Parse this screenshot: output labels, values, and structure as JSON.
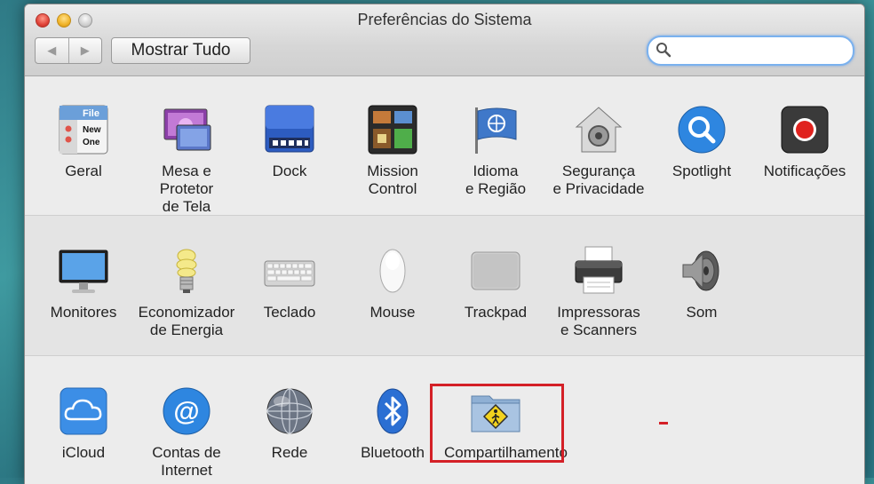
{
  "window": {
    "title": "Preferências do Sistema"
  },
  "toolbar": {
    "back_label": "◀",
    "forward_label": "▶",
    "show_all_label": "Mostrar Tudo",
    "search": {
      "value": "",
      "placeholder": ""
    }
  },
  "sections": [
    {
      "panes": [
        {
          "label": "Geral",
          "icon": "general-icon"
        },
        {
          "label": "Mesa e Protetor\nde Tela",
          "icon": "desktop-screensaver-icon"
        },
        {
          "label": "Dock",
          "icon": "dock-icon"
        },
        {
          "label": "Mission\nControl",
          "icon": "mission-control-icon"
        },
        {
          "label": "Idioma\ne Região",
          "icon": "language-region-icon"
        },
        {
          "label": "Segurança\ne Privacidade",
          "icon": "security-privacy-icon"
        },
        {
          "label": "Spotlight",
          "icon": "spotlight-icon"
        },
        {
          "label": "Notificações",
          "icon": "notifications-icon"
        }
      ]
    },
    {
      "panes": [
        {
          "label": "Monitores",
          "icon": "displays-icon"
        },
        {
          "label": "Economizador\nde Energia",
          "icon": "energy-saver-icon"
        },
        {
          "label": "Teclado",
          "icon": "keyboard-icon"
        },
        {
          "label": "Mouse",
          "icon": "mouse-icon"
        },
        {
          "label": "Trackpad",
          "icon": "trackpad-icon"
        },
        {
          "label": "Impressoras\ne Scanners",
          "icon": "printers-scanners-icon"
        },
        {
          "label": "Som",
          "icon": "sound-icon"
        }
      ]
    },
    {
      "panes": [
        {
          "label": "iCloud",
          "icon": "icloud-icon"
        },
        {
          "label": "Contas de\nInternet",
          "icon": "internet-accounts-icon"
        },
        {
          "label": "Rede",
          "icon": "network-icon"
        },
        {
          "label": "Bluetooth",
          "icon": "bluetooth-icon"
        },
        {
          "label": "Compartilhamento",
          "icon": "sharing-icon"
        }
      ]
    }
  ],
  "general_icon_text": {
    "line1": "File",
    "line2": "New",
    "line3": "One"
  },
  "colors": {
    "highlight": "#d42027",
    "search_focus": "#7ab1ee"
  }
}
